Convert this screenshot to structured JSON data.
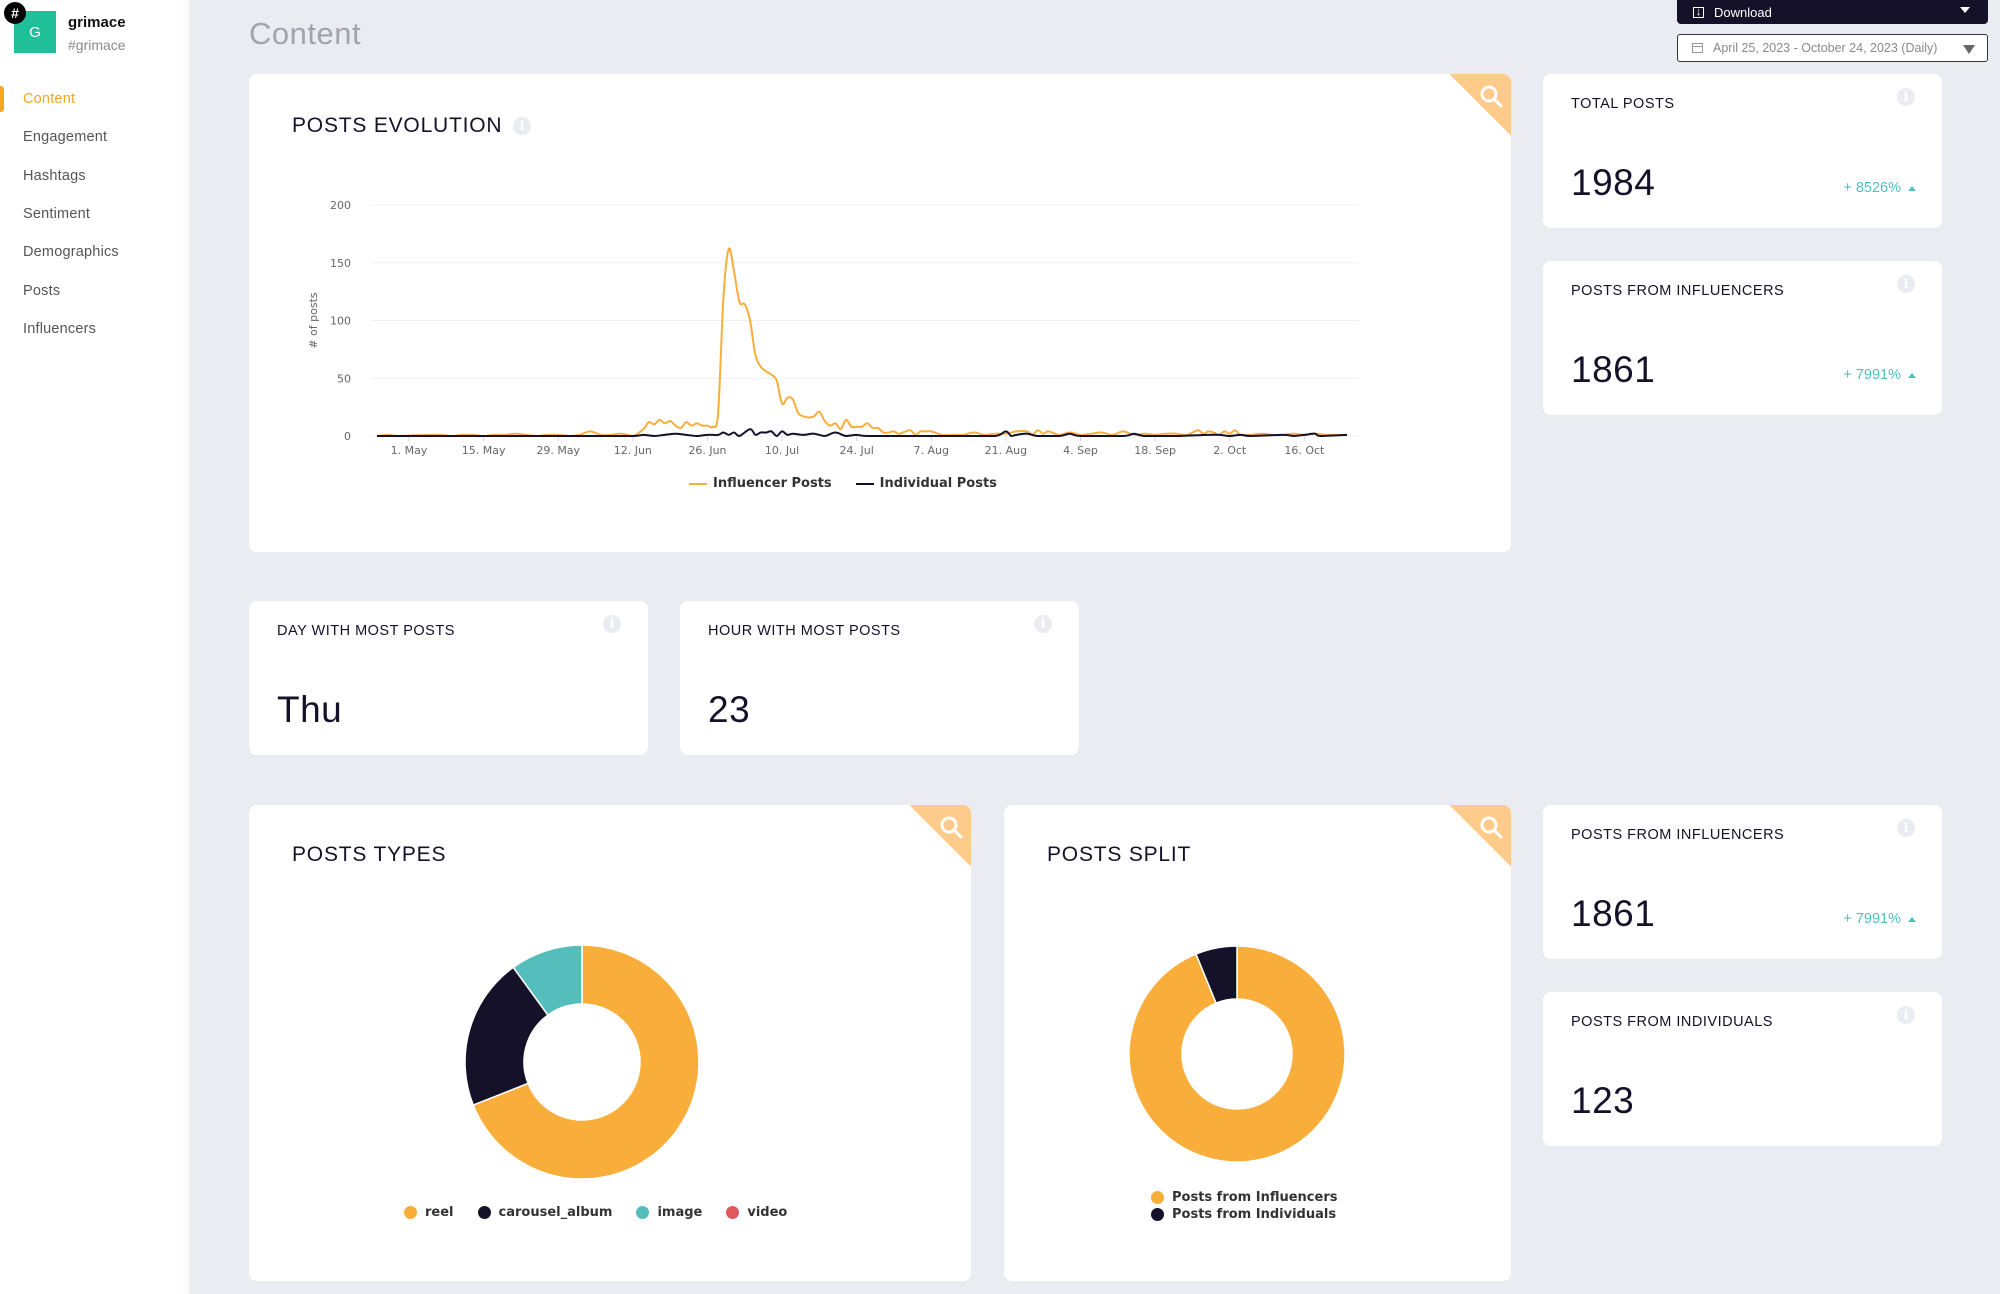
{
  "brand": {
    "initial": "G",
    "badge": "#",
    "name": "grimace",
    "handle": "#grimace"
  },
  "nav": [
    {
      "label": "Content",
      "active": true
    },
    {
      "label": "Engagement"
    },
    {
      "label": "Hashtags"
    },
    {
      "label": "Sentiment"
    },
    {
      "label": "Demographics"
    },
    {
      "label": "Posts"
    },
    {
      "label": "Influencers"
    }
  ],
  "page": {
    "title": "Content"
  },
  "toolbar": {
    "download_label": "Download",
    "date_range": "April 25, 2023 - October 24, 2023 (Daily)"
  },
  "evolution": {
    "title": "POSTS EVOLUTION"
  },
  "stats": {
    "total_posts": {
      "label": "TOTAL POSTS",
      "value": "1984",
      "change": "+ 8526%"
    },
    "influencers_top": {
      "label": "POSTS FROM INFLUENCERS",
      "value": "1861",
      "change": "+ 7991%"
    },
    "day_most": {
      "label": "DAY WITH MOST POSTS",
      "value": "Thu"
    },
    "hour_most": {
      "label": "HOUR WITH MOST POSTS",
      "value": "23"
    },
    "influencers_bottom": {
      "label": "POSTS FROM INFLUENCERS",
      "value": "1861",
      "change": "+ 7991%"
    },
    "individuals": {
      "label": "POSTS FROM INDIVIDUALS",
      "value": "123"
    }
  },
  "types": {
    "title": "POSTS TYPES"
  },
  "split": {
    "title": "POSTS SPLIT"
  },
  "colors": {
    "accent": "#f5a623",
    "orange": "#f9ae3b",
    "navy": "#151129",
    "teal": "#56bdbd",
    "red": "#e2575e",
    "positive": "#4fbfbf"
  },
  "chart_data": [
    {
      "type": "line",
      "title": "POSTS EVOLUTION",
      "xlabel": "",
      "ylabel": "# of posts",
      "ylim": [
        0,
        200
      ],
      "yticks": [
        "0",
        "50",
        "100",
        "150",
        "200"
      ],
      "x_start": "2023-04-25",
      "x_end": "2023-10-24",
      "xticks": [
        {
          "label": "1. May",
          "day": 6
        },
        {
          "label": "15. May",
          "day": 20
        },
        {
          "label": "29. May",
          "day": 34
        },
        {
          "label": "12. Jun",
          "day": 48
        },
        {
          "label": "26. Jun",
          "day": 62
        },
        {
          "label": "10. Jul",
          "day": 76
        },
        {
          "label": "24. Jul",
          "day": 90
        },
        {
          "label": "7. Aug",
          "day": 104
        },
        {
          "label": "21. Aug",
          "day": 118
        },
        {
          "label": "4. Sep",
          "day": 132
        },
        {
          "label": "18. Sep",
          "day": 146
        },
        {
          "label": "2. Oct",
          "day": 160
        },
        {
          "label": "16. Oct",
          "day": 174
        }
      ],
      "grid": true,
      "legend": "bottom",
      "series": [
        {
          "name": "Influencer Posts",
          "color": "#f9ae3b",
          "points": [
            [
              0,
              0
            ],
            [
              2,
              1
            ],
            [
              4,
              0
            ],
            [
              10,
              1
            ],
            [
              12,
              1
            ],
            [
              14,
              0
            ],
            [
              16,
              1
            ],
            [
              18,
              1
            ],
            [
              20,
              0
            ],
            [
              22,
              1
            ],
            [
              24,
              1
            ],
            [
              26,
              2
            ],
            [
              28,
              1
            ],
            [
              30,
              0
            ],
            [
              32,
              1
            ],
            [
              34,
              1
            ],
            [
              36,
              0
            ],
            [
              38,
              1
            ],
            [
              40,
              4
            ],
            [
              42,
              1
            ],
            [
              44,
              1
            ],
            [
              46,
              2
            ],
            [
              48,
              0
            ],
            [
              50,
              6
            ],
            [
              51,
              12
            ],
            [
              52,
              10
            ],
            [
              53,
              14
            ],
            [
              54,
              11
            ],
            [
              55,
              13
            ],
            [
              56,
              9
            ],
            [
              57,
              7
            ],
            [
              58,
              12
            ],
            [
              59,
              9
            ],
            [
              60,
              11
            ],
            [
              61,
              9
            ],
            [
              62,
              9
            ],
            [
              63,
              8
            ],
            [
              64,
              20
            ],
            [
              65,
              120
            ],
            [
              66,
              162
            ],
            [
              67,
              142
            ],
            [
              68,
              116
            ],
            [
              69,
              114
            ],
            [
              70,
              100
            ],
            [
              71,
              70
            ],
            [
              72,
              60
            ],
            [
              73,
              56
            ],
            [
              74,
              53
            ],
            [
              75,
              48
            ],
            [
              76,
              28
            ],
            [
              77,
              33
            ],
            [
              78,
              32
            ],
            [
              79,
              20
            ],
            [
              80,
              17
            ],
            [
              81,
              16
            ],
            [
              82,
              17
            ],
            [
              83,
              21
            ],
            [
              84,
              13
            ],
            [
              85,
              9
            ],
            [
              86,
              11
            ],
            [
              87,
              6
            ],
            [
              88,
              14
            ],
            [
              89,
              8
            ],
            [
              90,
              8
            ],
            [
              91,
              8
            ],
            [
              92,
              11
            ],
            [
              93,
              7
            ],
            [
              94,
              7
            ],
            [
              95,
              3
            ],
            [
              96,
              3
            ],
            [
              97,
              4
            ],
            [
              98,
              2
            ],
            [
              100,
              5
            ],
            [
              101,
              1
            ],
            [
              102,
              4
            ],
            [
              103,
              4
            ],
            [
              104,
              4
            ],
            [
              106,
              1
            ],
            [
              108,
              1
            ],
            [
              110,
              1
            ],
            [
              112,
              3
            ],
            [
              114,
              1
            ],
            [
              116,
              2
            ],
            [
              118,
              2
            ],
            [
              120,
              4
            ],
            [
              122,
              4
            ],
            [
              123,
              1
            ],
            [
              124,
              5
            ],
            [
              125,
              2
            ],
            [
              126,
              4
            ],
            [
              128,
              1
            ],
            [
              130,
              3
            ],
            [
              132,
              1
            ],
            [
              134,
              2
            ],
            [
              136,
              3
            ],
            [
              138,
              1
            ],
            [
              140,
              4
            ],
            [
              142,
              1
            ],
            [
              144,
              2
            ],
            [
              146,
              1
            ],
            [
              148,
              2
            ],
            [
              150,
              2
            ],
            [
              152,
              1
            ],
            [
              154,
              5
            ],
            [
              155,
              2
            ],
            [
              156,
              4
            ],
            [
              157,
              3
            ],
            [
              158,
              1
            ],
            [
              159,
              4
            ],
            [
              160,
              2
            ],
            [
              161,
              5
            ],
            [
              162,
              1
            ],
            [
              164,
              1
            ],
            [
              166,
              2
            ],
            [
              168,
              1
            ],
            [
              170,
              1
            ],
            [
              172,
              2
            ],
            [
              174,
              1
            ],
            [
              176,
              2
            ],
            [
              178,
              1
            ],
            [
              180,
              1
            ],
            [
              182,
              1
            ]
          ]
        },
        {
          "name": "Individual Posts",
          "color": "#151129",
          "points": [
            [
              0,
              0
            ],
            [
              20,
              0
            ],
            [
              40,
              0
            ],
            [
              48,
              0
            ],
            [
              50,
              1
            ],
            [
              52,
              0
            ],
            [
              54,
              1
            ],
            [
              56,
              2
            ],
            [
              58,
              1
            ],
            [
              60,
              0
            ],
            [
              62,
              1
            ],
            [
              64,
              1
            ],
            [
              65,
              3
            ],
            [
              66,
              1
            ],
            [
              67,
              3
            ],
            [
              68,
              0
            ],
            [
              70,
              6
            ],
            [
              71,
              1
            ],
            [
              72,
              3
            ],
            [
              73,
              3
            ],
            [
              74,
              4
            ],
            [
              75,
              0
            ],
            [
              76,
              4
            ],
            [
              77,
              1
            ],
            [
              78,
              2
            ],
            [
              80,
              1
            ],
            [
              82,
              2
            ],
            [
              84,
              0
            ],
            [
              86,
              3
            ],
            [
              88,
              0
            ],
            [
              90,
              1
            ],
            [
              92,
              0
            ],
            [
              100,
              0
            ],
            [
              110,
              0
            ],
            [
              116,
              0
            ],
            [
              118,
              4
            ],
            [
              119,
              0
            ],
            [
              120,
              1
            ],
            [
              122,
              2
            ],
            [
              124,
              0
            ],
            [
              128,
              0
            ],
            [
              130,
              2
            ],
            [
              132,
              0
            ],
            [
              140,
              0
            ],
            [
              142,
              2
            ],
            [
              144,
              0
            ],
            [
              150,
              0
            ],
            [
              156,
              1
            ],
            [
              158,
              1
            ],
            [
              160,
              0
            ],
            [
              162,
              1
            ],
            [
              164,
              0
            ],
            [
              170,
              1
            ],
            [
              172,
              0
            ],
            [
              174,
              1
            ],
            [
              176,
              2
            ],
            [
              177,
              0
            ],
            [
              182,
              1
            ]
          ]
        }
      ]
    },
    {
      "type": "pie",
      "title": "POSTS TYPES",
      "donut": true,
      "legend": "bottom",
      "slices": [
        {
          "label": "reel",
          "value": 69,
          "color": "#f9ae3b"
        },
        {
          "label": "carousel_album",
          "value": 21,
          "color": "#151129"
        },
        {
          "label": "image",
          "value": 10,
          "color": "#56bdbd"
        },
        {
          "label": "video",
          "value": 0,
          "color": "#e2575e"
        }
      ]
    },
    {
      "type": "pie",
      "title": "POSTS SPLIT",
      "donut": true,
      "legend": "bottom",
      "slices": [
        {
          "label": "Posts from Influencers",
          "value": 1861,
          "color": "#f9ae3b"
        },
        {
          "label": "Posts from Individuals",
          "value": 123,
          "color": "#151129"
        }
      ]
    }
  ]
}
